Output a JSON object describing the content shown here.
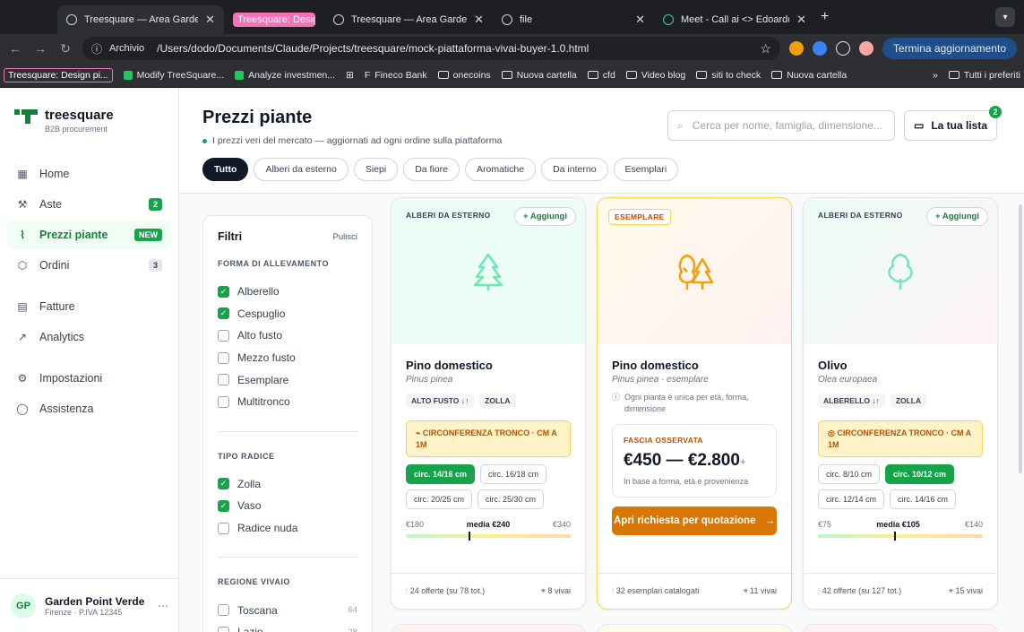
{
  "browser": {
    "tabs": [
      {
        "label": "Treesquare — Area Garden Po"
      },
      {
        "label": "Treesquare: Design"
      },
      {
        "label": "Treesquare — Area Garden Po"
      },
      {
        "label": "file"
      },
      {
        "label": "Meet - Call ai <> Edoardo"
      }
    ],
    "archivio": "Archivio",
    "url": "/Users/dodo/Documents/Claude/Projects/treesquare/mock-piattaforma-vivai-buyer-1.0.html",
    "update": "Termina aggiornamento",
    "bookmarks": [
      "Treesquare: Design pi...",
      "Modify TreeSquare...",
      "Analyze investmen...",
      "Fineco Bank",
      "onecoins",
      "Nuova cartella",
      "cfd",
      "Video blog",
      "siti to check",
      "Nuova cartella",
      "Tutti i preferiti"
    ]
  },
  "brand": {
    "name": "treesquare",
    "sub": "B2B procurement"
  },
  "sidebar": {
    "items": [
      {
        "label": "Home",
        "icon": "grid-icon"
      },
      {
        "label": "Aste",
        "icon": "gavel-icon",
        "badge": "2"
      },
      {
        "label": "Prezzi piante",
        "icon": "chart-icon",
        "badge": "NEW"
      },
      {
        "label": "Ordini",
        "icon": "box-icon",
        "badge": "3"
      },
      {
        "label": "Fatture",
        "icon": "document-icon"
      },
      {
        "label": "Analytics",
        "icon": "trend-icon"
      },
      {
        "label": "Impostazioni",
        "icon": "gear-icon"
      },
      {
        "label": "Assistenza",
        "icon": "chat-icon"
      }
    ]
  },
  "user": {
    "initials": "GP",
    "name": "Garden Point Verde",
    "sub": "Firenze · P.IVA 12345"
  },
  "header": {
    "title": "Prezzi piante",
    "subtitle": "I prezzi veri del mercato — aggiornati ad ogni ordine sulla piattaforma",
    "search_placeholder": "Cerca per nome, famiglia, dimensione...",
    "list_label": "La tua lista",
    "list_count": "2"
  },
  "chips": [
    "Tutto",
    "Alberi da esterno",
    "Siepi",
    "Da fiore",
    "Aromatiche",
    "Da interno",
    "Esemplari"
  ],
  "filters": {
    "title": "Filtri",
    "clear": "Pulisci",
    "sections": [
      {
        "title": "FORMA DI ALLEVAMENTO",
        "options": [
          {
            "label": "Alberello",
            "checked": true
          },
          {
            "label": "Cespuglio",
            "checked": true
          },
          {
            "label": "Alto fusto",
            "checked": false
          },
          {
            "label": "Mezzo fusto",
            "checked": false
          },
          {
            "label": "Esemplare",
            "checked": false
          },
          {
            "label": "Multitronco",
            "checked": false
          }
        ]
      },
      {
        "title": "TIPO RADICE",
        "options": [
          {
            "label": "Zolla",
            "checked": true
          },
          {
            "label": "Vaso",
            "checked": true
          },
          {
            "label": "Radice nuda",
            "checked": false
          }
        ]
      },
      {
        "title": "REGIONE VIVAIO",
        "options": [
          {
            "label": "Toscana",
            "checked": false,
            "count": "64"
          },
          {
            "label": "Lazio",
            "checked": false,
            "count": "28"
          }
        ]
      }
    ]
  },
  "cards": [
    {
      "category": "ALBERI DA ESTERNO",
      "add": "+ Aggiungi",
      "name": "Pino domestico",
      "sci": "Pinus pinea",
      "tags": [
        "ALTO FUSTO ↓↑",
        "ZOLLA"
      ],
      "circ": "CIRCONFERENZA TRONCO · CM A 1M",
      "sizes": [
        "circ. 14/16 cm",
        "circ. 16/18 cm",
        "circ. 20/25 cm",
        "circ. 25/30 cm"
      ],
      "selected": 0,
      "min": "€180",
      "mid": "media €240",
      "max": "€340",
      "median": 0.38,
      "offers": "24 offerte (su 78 tot.)",
      "nurseries": "8 vivai"
    },
    {
      "category": "ESEMPLARE",
      "name": "Pino domestico",
      "sci": "Pinus pinea · esemplare",
      "note": "Ogni pianta è unica per età, forma, dimensione",
      "obs_label": "FASCIA OSSERVATA",
      "obs_price": "€450 — €2.800",
      "obs_plus": "+",
      "obs_desc": "In base a forma, età e provenienza",
      "cta": "Apri richiesta per quotazione",
      "stats": "32 esemplari catalogati",
      "nurseries": "11 vivai"
    },
    {
      "category": "ALBERI DA ESTERNO",
      "add": "+ Aggiungi",
      "name": "Olivo",
      "sci": "Olea europaea",
      "tags": [
        "ALBERELLO ↓↑",
        "ZOLLA"
      ],
      "circ": "CIRCONFERENZA TRONCO · CM A 1M",
      "sizes": [
        "circ. 8/10 cm",
        "circ. 10/12 cm",
        "circ. 12/14 cm",
        "circ. 14/16 cm"
      ],
      "selected": 1,
      "min": "€75",
      "mid": "media €105",
      "max": "€140",
      "median": 0.46,
      "offers": "42 offerte (su 127 tot.)",
      "nurseries": "15 vivai"
    }
  ]
}
